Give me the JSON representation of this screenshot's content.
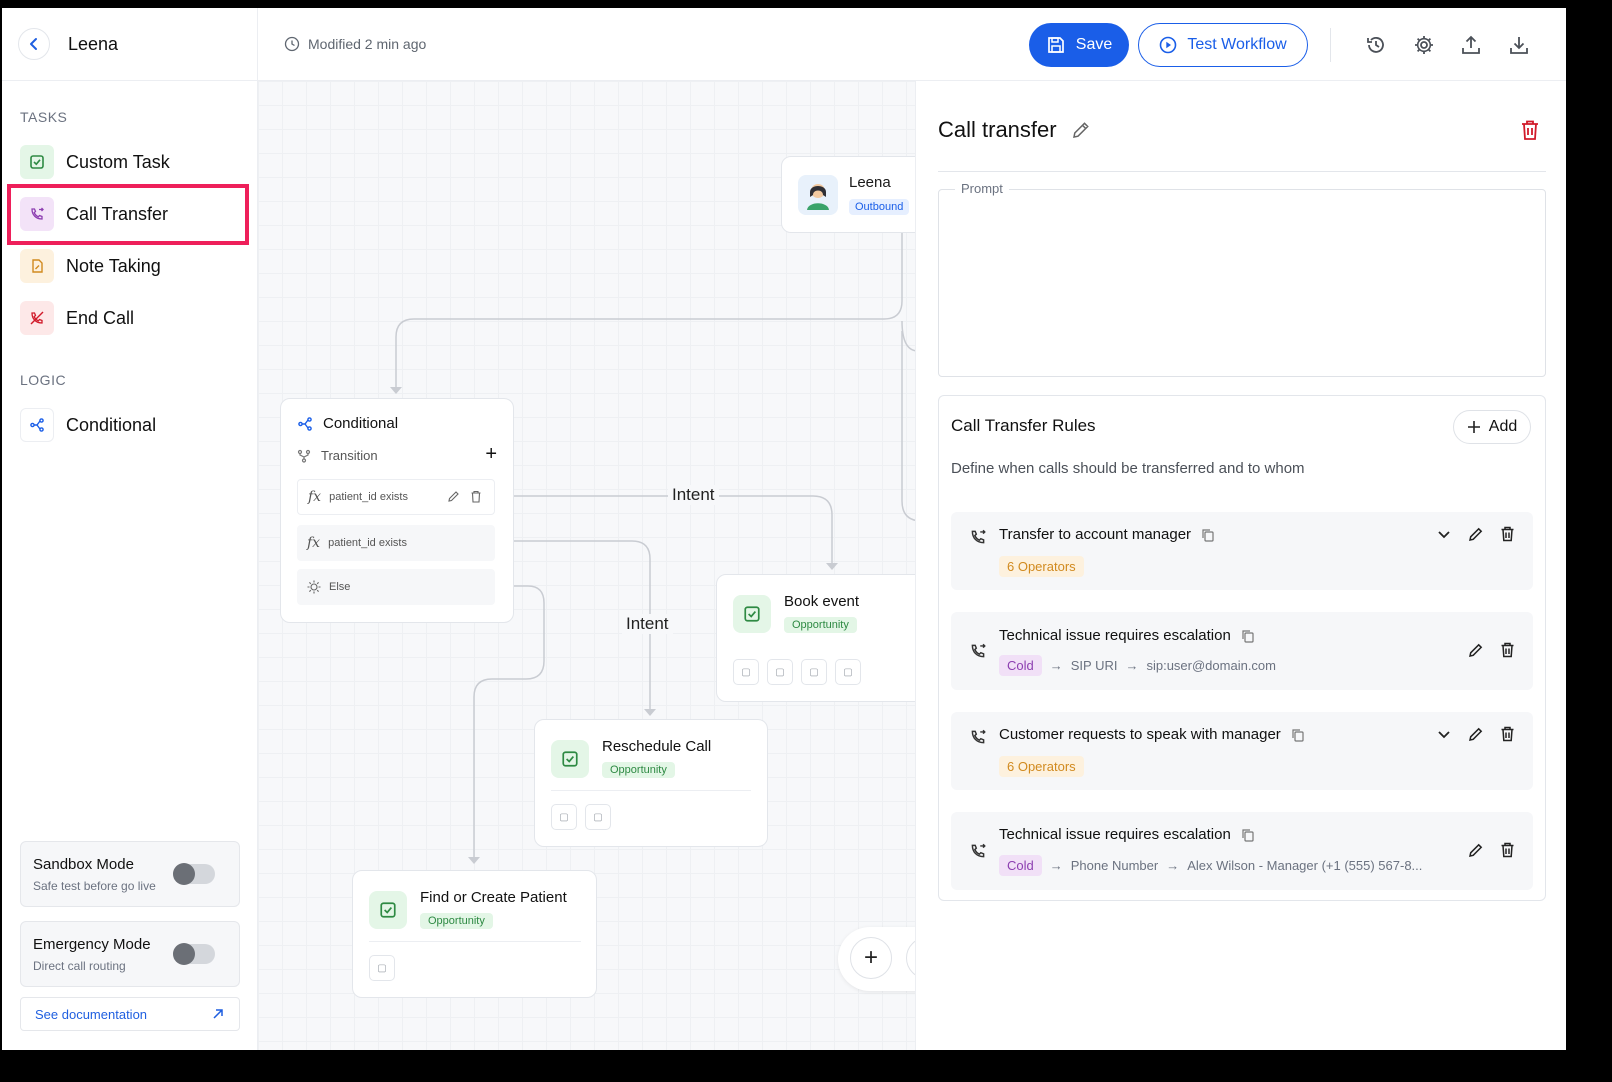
{
  "app": {
    "name": "Leena",
    "modified": "Modified 2 min ago"
  },
  "toolbar": {
    "save_label": "Save",
    "test_label": "Test Workflow",
    "icons": [
      "history-icon",
      "settings-icon",
      "upload-icon",
      "download-icon"
    ]
  },
  "sidebar": {
    "tasks_label": "TASKS",
    "tasks": [
      {
        "label": "Custom Task",
        "icon": "check-square-icon",
        "color": "#2e8a43"
      },
      {
        "label": "Call Transfer",
        "icon": "phone-transfer-icon",
        "color": "#8d3fb1"
      },
      {
        "label": "Note Taking",
        "icon": "note-icon",
        "color": "#d18a1f"
      },
      {
        "label": "End Call",
        "icon": "phone-off-icon",
        "color": "#d11a2a"
      }
    ],
    "logic_label": "LOGIC",
    "logic": [
      {
        "label": "Conditional",
        "icon": "branch-icon",
        "color": "#1a5ee8"
      }
    ],
    "sandbox": {
      "title": "Sandbox Mode",
      "subtitle": "Safe test before go live",
      "on": false
    },
    "emergency": {
      "title": "Emergency Mode",
      "subtitle": "Direct call routing",
      "on": false
    },
    "doc_link": "See documentation"
  },
  "canvas": {
    "agent_node": {
      "name": "Leena",
      "badge": "Outbound"
    },
    "conditional_node": {
      "title": "Conditional",
      "transition_label": "Transition",
      "rows": [
        "patient_id exists",
        "patient_id exists",
        "Else"
      ]
    },
    "edge_labels": [
      "Intent",
      "Intent"
    ],
    "task_nodes": [
      {
        "title": "Book event",
        "badge": "Opportunity"
      },
      {
        "title": "Reschedule Call",
        "badge": "Opportunity"
      },
      {
        "title": "Find or Create Patient",
        "badge": "Opportunity"
      }
    ]
  },
  "panel": {
    "title": "Call transfer",
    "prompt_label": "Prompt",
    "prompt_value": "",
    "rules_title": "Call Transfer Rules",
    "add_label": "Add",
    "rules_desc": "Define when calls should be transferred and to whom",
    "rules": [
      {
        "name": "Transfer to account manager",
        "tag": "6 Operators",
        "expandable": true
      },
      {
        "name": "Technical issue requires escalation",
        "tag": "Cold",
        "type": "SIP URI",
        "target": "sip:user@domain.com",
        "expandable": false
      },
      {
        "name": "Customer requests to speak with manager",
        "tag": "6 Operators",
        "expandable": true
      },
      {
        "name": "Technical issue requires escalation",
        "tag": "Cold",
        "type": "Phone Number",
        "target": "Alex Wilson - Manager (+1 (555) 567-8...",
        "expandable": false
      }
    ]
  },
  "colors": {
    "accent": "#1a5ee8",
    "highlight": "#ee1f5a",
    "danger": "#d11a2a"
  }
}
